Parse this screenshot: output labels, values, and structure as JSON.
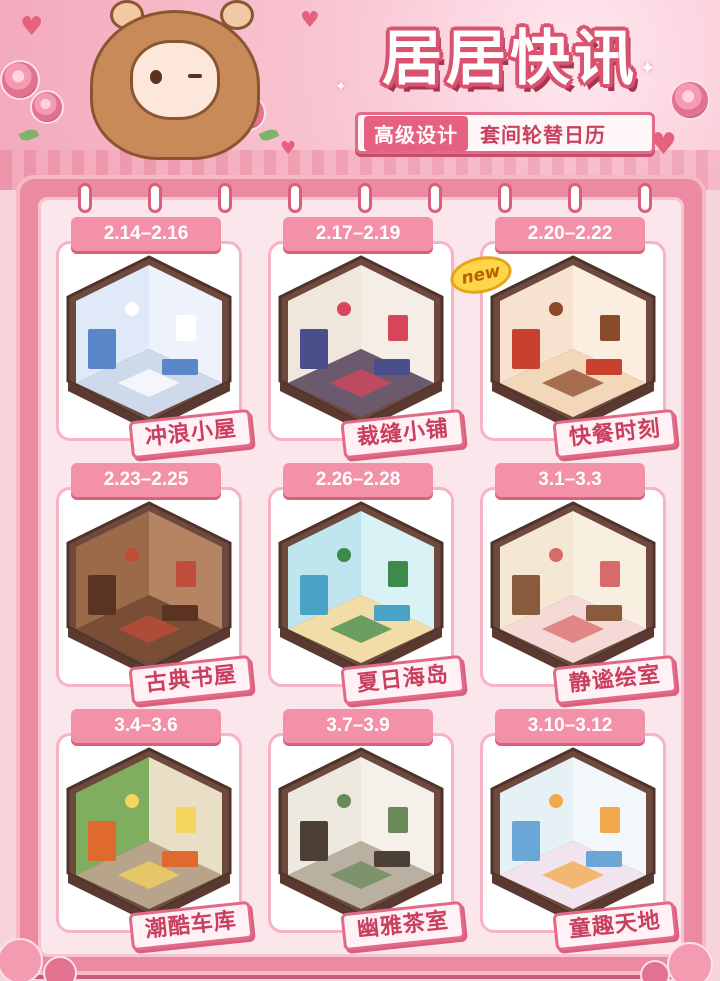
{
  "header": {
    "title": "居居快讯",
    "subtitle_tag": "高级设计",
    "subtitle_text": "套间轮替日历"
  },
  "badge": {
    "new_label": "new"
  },
  "colors": {
    "accent": "#e6607f",
    "board": "#ec8aa2",
    "panel": "#fbe6ec",
    "label_text": "#c9405f"
  },
  "rooms": [
    {
      "date": "2.14–2.16",
      "name": "冲浪小屋",
      "theme": "bathroom-blue"
    },
    {
      "date": "2.17–2.19",
      "name": "裁缝小铺",
      "theme": "tailor-shop"
    },
    {
      "date": "2.20–2.22",
      "name": "快餐时刻",
      "theme": "fast-food",
      "is_new": true
    },
    {
      "date": "2.23–2.25",
      "name": "古典书屋",
      "theme": "study-brown"
    },
    {
      "date": "2.26–2.28",
      "name": "夏日海岛",
      "theme": "beach-island"
    },
    {
      "date": "3.1–3.3",
      "name": "静谧绘室",
      "theme": "art-studio"
    },
    {
      "date": "3.4–3.6",
      "name": "潮酷车库",
      "theme": "garage-orange"
    },
    {
      "date": "3.7–3.9",
      "name": "幽雅茶室",
      "theme": "tea-room"
    },
    {
      "date": "3.10–3.12",
      "name": "童趣天地",
      "theme": "kids-room"
    }
  ]
}
